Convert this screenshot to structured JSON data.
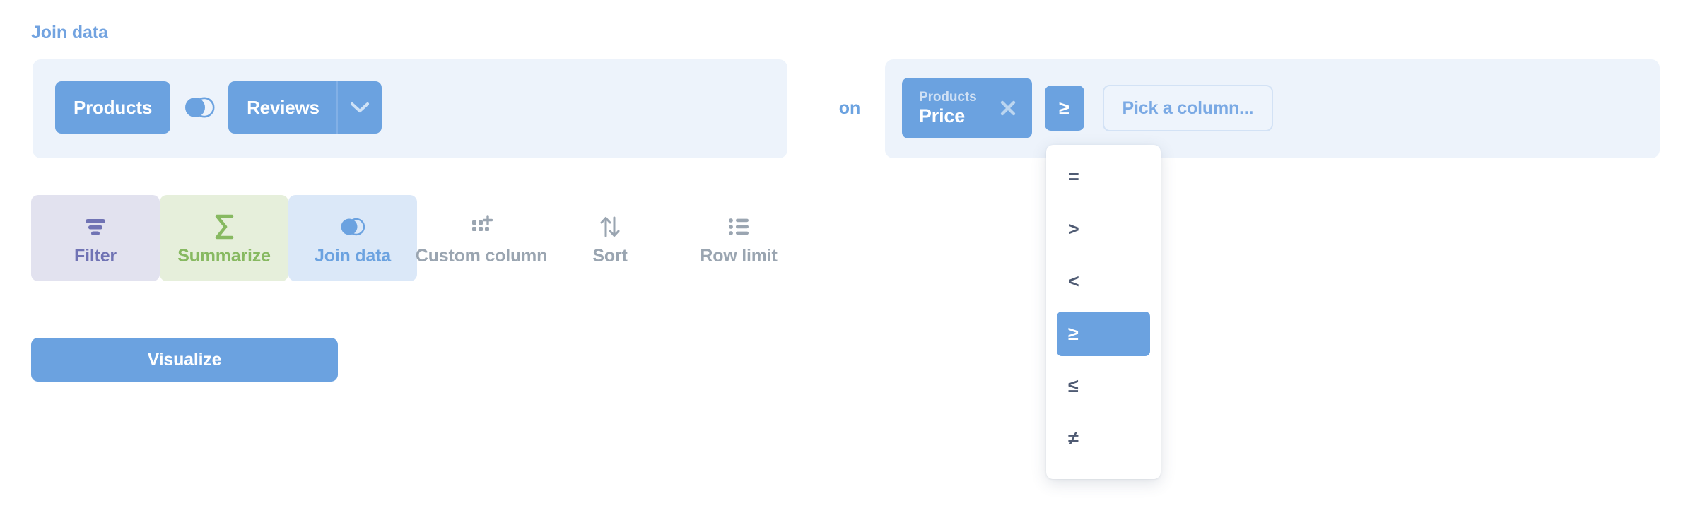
{
  "section": {
    "title": "Join data"
  },
  "join": {
    "left_table": "Products",
    "join_type_icon": "venn-left-join-icon",
    "right_table": "Reviews",
    "right_table_chevron_icon": "chevron-down-icon",
    "on_keyword": "on",
    "condition": {
      "left_column": {
        "table": "Products",
        "field": "Price",
        "remove_icon": "close-icon"
      },
      "operator": "≥",
      "right_column_placeholder": "Pick a column..."
    }
  },
  "operator_menu": {
    "selected": "≥",
    "items": [
      {
        "symbol": "=",
        "selected": false
      },
      {
        "symbol": ">",
        "selected": false
      },
      {
        "symbol": "<",
        "selected": false
      },
      {
        "symbol": "≥",
        "selected": true
      },
      {
        "symbol": "≤",
        "selected": false
      },
      {
        "symbol": "≠",
        "selected": false
      }
    ]
  },
  "toolbar": {
    "actions": [
      {
        "label": "Filter",
        "icon": "filter-icon",
        "state": "active"
      },
      {
        "label": "Summarize",
        "icon": "sigma-icon",
        "state": "active"
      },
      {
        "label": "Join data",
        "icon": "venn-join-icon",
        "state": "active"
      },
      {
        "label": "Custom column",
        "icon": "grid-plus-icon",
        "state": "plain"
      },
      {
        "label": "Sort",
        "icon": "sort-arrows-icon",
        "state": "plain"
      },
      {
        "label": "Row limit",
        "icon": "list-icon",
        "state": "plain"
      }
    ]
  },
  "footer": {
    "visualize_label": "Visualize"
  },
  "colors": {
    "brand_blue": "#6ba2e0",
    "strip_background": "#edf3fb",
    "filter_purple": "#7073b4",
    "summarize_green": "#87b961",
    "muted_gray": "#9aa5b1"
  }
}
